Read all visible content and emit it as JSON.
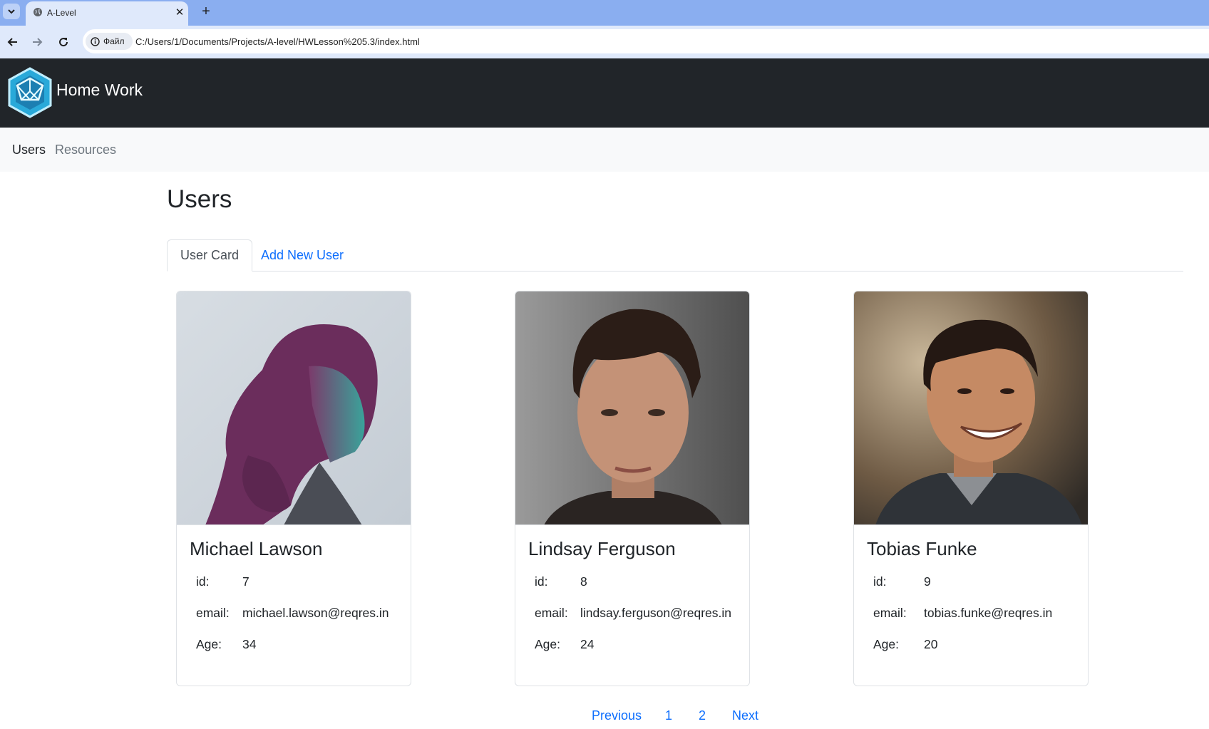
{
  "browser": {
    "tab_title": "A-Level",
    "site_chip": "Файл",
    "url": "C:/Users/1/Documents/Projects/A-level/HWLesson%205.3/index.html",
    "icons": [
      "chevron-down-icon",
      "globe-icon",
      "close-icon",
      "plus-icon",
      "back-arrow-icon",
      "forward-arrow-icon",
      "reload-icon",
      "info-icon"
    ]
  },
  "header": {
    "brand": "Home Work",
    "logo_icon": "hexagon-logo-icon"
  },
  "subnav": {
    "items": [
      {
        "label": "Users",
        "active": true
      },
      {
        "label": "Resources",
        "active": false
      }
    ]
  },
  "main": {
    "title": "Users",
    "tabs": [
      {
        "label": "User Card",
        "active": true
      },
      {
        "label": "Add New User",
        "active": false
      }
    ],
    "labels": {
      "id": "id:",
      "email": "email:",
      "age": "Age:"
    },
    "users": [
      {
        "name": "Michael Lawson",
        "id": "7",
        "email": "michael.lawson@reqres.in",
        "age": "34"
      },
      {
        "name": "Lindsay Ferguson",
        "id": "8",
        "email": "lindsay.ferguson@reqres.in",
        "age": "24"
      },
      {
        "name": "Tobias Funke",
        "id": "9",
        "email": "tobias.funke@reqres.in",
        "age": "20"
      }
    ]
  },
  "pagination": {
    "previous": "Previous",
    "pages": [
      "1",
      "2"
    ],
    "next": "Next"
  },
  "colors": {
    "link": "#0d6efd",
    "navbar_dark": "#212529",
    "tabstrip": "#8aaef0",
    "toolbar": "#dfe9fb"
  }
}
